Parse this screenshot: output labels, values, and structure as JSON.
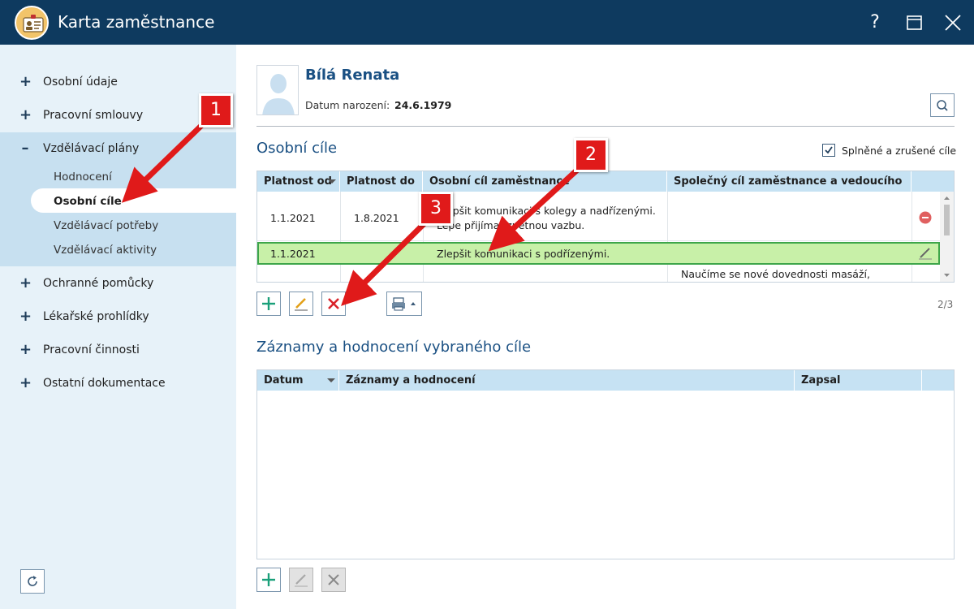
{
  "window": {
    "title": "Karta zaměstnance",
    "help_label": "?",
    "icons": [
      "id-card-icon",
      "help-icon",
      "maximize-icon",
      "close-icon"
    ]
  },
  "sidebar": {
    "items": [
      {
        "label": "Osobní údaje",
        "sign": "+"
      },
      {
        "label": "Pracovní smlouvy",
        "sign": "+"
      },
      {
        "label": "Vzdělávací plány",
        "sign": "–"
      },
      {
        "label": "Ochranné pomůcky",
        "sign": "+"
      },
      {
        "label": "Lékařské prohlídky",
        "sign": "+"
      },
      {
        "label": "Pracovní činnosti",
        "sign": "+"
      },
      {
        "label": "Ostatní dokumentace",
        "sign": "+"
      }
    ],
    "subitems": [
      "Hodnocení",
      "Osobní cíle",
      "Vzdělávací potřeby",
      "Vzdělávací aktivity"
    ],
    "active_subitem": "Osobní cíle"
  },
  "employee": {
    "name": "Bílá Renata",
    "birth_label": "Datum narození:",
    "birth_value": "24.6.1979"
  },
  "goals": {
    "title": "Osobní cíle",
    "checkbox_label": "Splněné a zrušené cíle",
    "checkbox_checked": true,
    "columns": [
      "Platnost od",
      "Platnost do",
      "Osobní cíl zaměstnance",
      "Společný cíl zaměstnance a vedoucího"
    ],
    "rows": [
      {
        "from": "1.1.2021",
        "to": "1.8.2021",
        "goal_line1": "Zlepšit komunikaci s kolegy a nadřízenými.",
        "goal_line2": "Lépe přijímat zpětnou vazbu.",
        "shared": "",
        "status": "removed"
      },
      {
        "from": "1.1.2021",
        "to": "",
        "goal_line1": "Zlepšit komunikaci s podřízenými.",
        "goal_line2": "",
        "shared": "",
        "status": "selected"
      },
      {
        "from": "",
        "to": "",
        "goal_line1": "",
        "goal_line2": "",
        "shared": "Naučíme se nové dovednosti masáží,",
        "status": ""
      }
    ],
    "page": "2/3"
  },
  "records": {
    "title": "Záznamy a hodnocení vybraného cíle",
    "columns": [
      "Datum",
      "Záznamy a hodnocení",
      "Zapsal"
    ]
  },
  "callouts": [
    "1",
    "2",
    "3"
  ],
  "colors": {
    "titlebar": "#0e3a5f",
    "sidebar": "#e7f2f9",
    "accent": "#1a5083",
    "selected_row": "#c8f0a8",
    "callout": "#e01a1a"
  }
}
